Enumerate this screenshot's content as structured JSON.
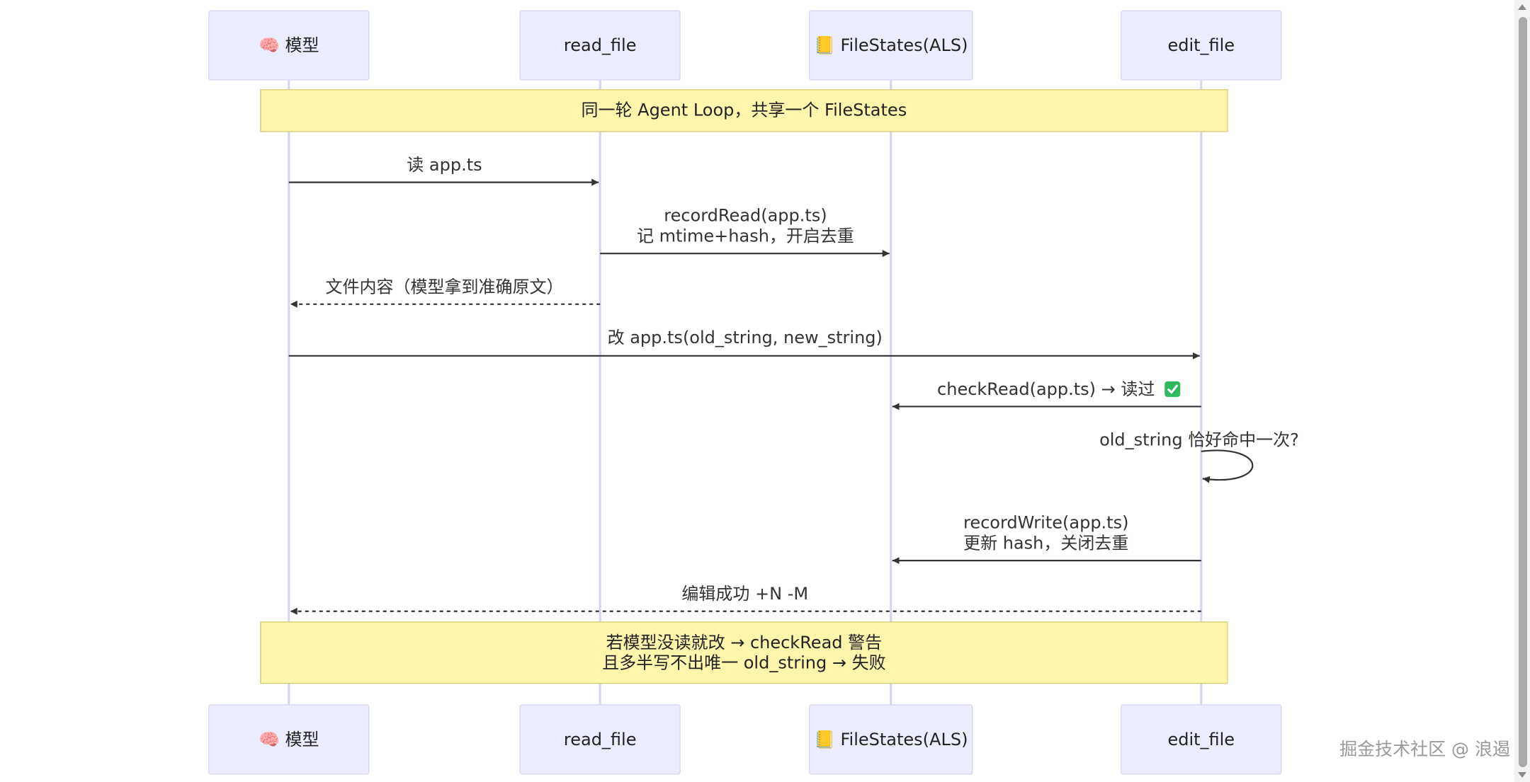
{
  "actors": [
    {
      "id": "model",
      "emoji": "🧠",
      "label": "模型",
      "icon": "brain-icon"
    },
    {
      "id": "read_file",
      "label": "read_file"
    },
    {
      "id": "filestates",
      "emoji": "📒",
      "label": "FileStates(ALS)",
      "icon": "notebook-icon"
    },
    {
      "id": "edit_file",
      "label": "edit_file"
    }
  ],
  "notes": [
    {
      "lines": [
        "同一轮 Agent Loop，共享一个 FileStates"
      ]
    },
    {
      "lines": [
        "若模型没读就改 → checkRead 警告",
        "且多半写不出唯一 old_string → 失败"
      ]
    }
  ],
  "messages": [
    {
      "from": "model",
      "to": "read_file",
      "style": "solid",
      "lines": [
        "读 app.ts"
      ]
    },
    {
      "from": "read_file",
      "to": "filestates",
      "style": "solid",
      "lines": [
        "recordRead(app.ts)",
        "记 mtime+hash，开启去重"
      ]
    },
    {
      "from": "read_file",
      "to": "model",
      "style": "dashed",
      "lines": [
        "文件内容（模型拿到准确原文）"
      ]
    },
    {
      "from": "model",
      "to": "edit_file",
      "style": "solid",
      "lines": [
        "改 app.ts(old_string, new_string)"
      ]
    },
    {
      "from": "edit_file",
      "to": "filestates",
      "style": "solid",
      "lines": [
        "checkRead(app.ts) → 读过"
      ],
      "check_icon": true
    },
    {
      "from": "edit_file",
      "to": "edit_file",
      "style": "self",
      "lines": [
        "old_string 恰好命中一次?"
      ]
    },
    {
      "from": "edit_file",
      "to": "filestates",
      "style": "solid",
      "lines": [
        "recordWrite(app.ts)",
        "更新 hash，关闭去重"
      ]
    },
    {
      "from": "edit_file",
      "to": "model",
      "style": "dashed",
      "lines": [
        "编辑成功 +N -M"
      ]
    }
  ],
  "watermark": "掘金技术社区 @ 浪遏",
  "colors": {
    "actor_fill": "#ECECFF",
    "note_fill": "#FFF5AD",
    "line": "#333333",
    "lifeline": "#d4d4ef"
  }
}
